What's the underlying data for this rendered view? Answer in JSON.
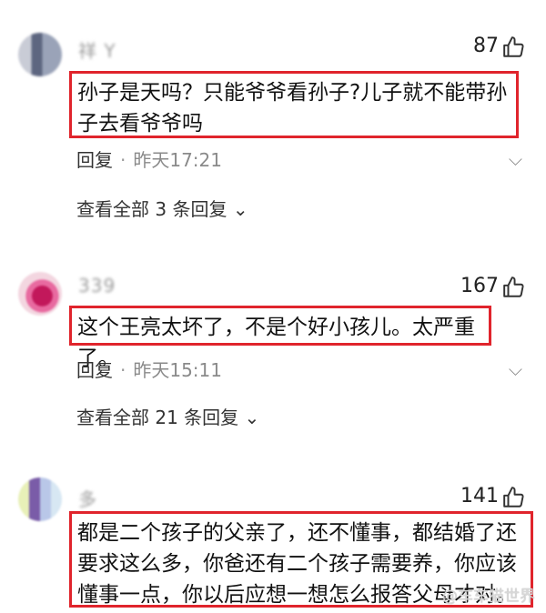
{
  "comments": [
    {
      "username": "祥 Y",
      "likes": "87",
      "text": "孙子是天吗？只能爷爷看孙子?儿子就不能带孙子去看爷爷吗",
      "reply_label": "回复",
      "time": "昨天17:21",
      "view_all": "查看全部 3 条回复"
    },
    {
      "username": "         339",
      "likes": "167",
      "text": "这个王亮太坏了，不是个好小孩儿。太严重了。",
      "reply_label": "回复",
      "time": "昨天15:11",
      "view_all": "查看全部 21 条回复"
    },
    {
      "username": "多",
      "likes": "141",
      "text": "都是二个孩子的父亲了，还不懂事，都结婚了还要求这么多，你爸还有二个孩子需要养，你应该懂事一点，你以后应想一想怎么报答父母才对。"
    }
  ],
  "separator": "·",
  "watermark": "@车车猫世界",
  "colors": {
    "highlight_border": "#e0242c",
    "text": "#111111",
    "meta": "#8a8a8a"
  },
  "icons": {
    "like": "thumbs-up-icon",
    "more": "chevron-down-icon",
    "expand": "chevron-down-icon"
  }
}
